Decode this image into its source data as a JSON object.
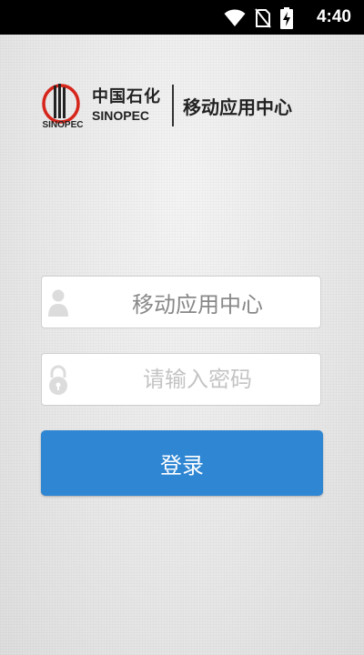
{
  "status_bar": {
    "time": "4:40",
    "icons": [
      "wifi-icon",
      "no-sim-icon",
      "battery-charging-icon"
    ]
  },
  "header": {
    "logo_name": "sinopec-logo",
    "brand_cn": "中国石化",
    "brand_en": "SINOPEC",
    "app_title": "移动应用中心"
  },
  "form": {
    "username": {
      "value": "移动应用中心",
      "icon": "user-icon"
    },
    "password": {
      "value": "",
      "placeholder": "请输入密码",
      "icon": "lock-icon"
    },
    "login_label": "登录"
  },
  "colors": {
    "button": "#2f86d3",
    "status_bar": "#000000",
    "logo_red": "#d6261c"
  }
}
